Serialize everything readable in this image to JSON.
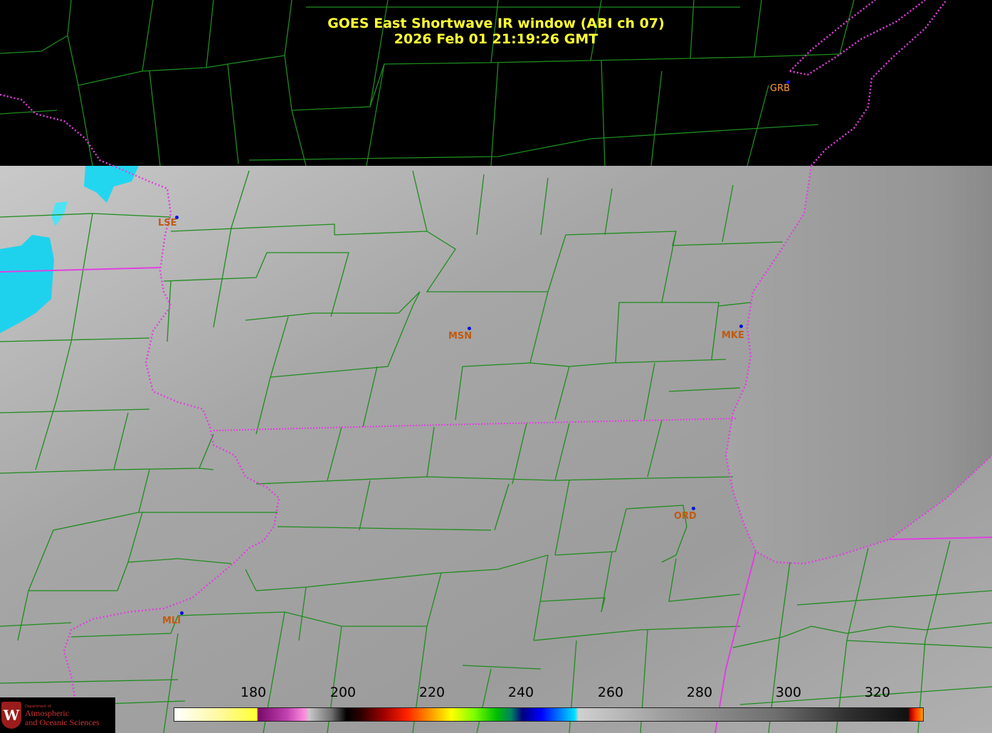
{
  "title": {
    "line1": "GOES East Shortwave IR window (ABI ch 07)",
    "line2": "2026 Feb 01  21:19:26 GMT"
  },
  "cities": [
    {
      "code": "GRB"
    },
    {
      "code": "LSE"
    },
    {
      "code": "MSN"
    },
    {
      "code": "MKE"
    },
    {
      "code": "ORD"
    },
    {
      "code": "MLI"
    }
  ],
  "colorbar": {
    "ticks": [
      "180",
      "200",
      "220",
      "240",
      "260",
      "280",
      "300",
      "320"
    ],
    "colors": {
      "land_border": "#1e8c1e",
      "state_border": "#e040e0",
      "city_label": "#ff9a3c",
      "city_dot": "#0010e0",
      "cold_cloud": "#00e5ff"
    }
  },
  "logo": {
    "small": "Department of",
    "line1": "Atmospheric",
    "line2": "and Oceanic Sciences",
    "letter": "W"
  }
}
